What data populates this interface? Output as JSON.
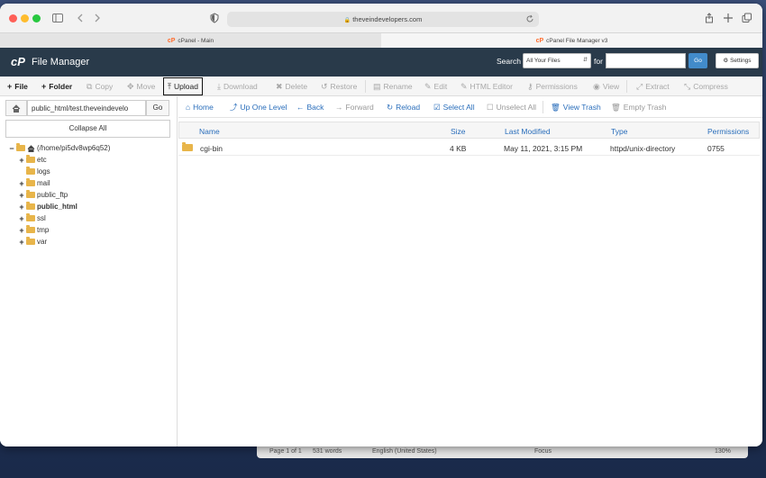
{
  "browser": {
    "url": "theveindevelopers.com",
    "tabs": [
      {
        "label": "cPanel - Main",
        "active": false
      },
      {
        "label": "cPanel File Manager v3",
        "active": true
      }
    ]
  },
  "header": {
    "logo": "cP",
    "title": "File Manager",
    "search_label": "Search",
    "search_scope": "All Your Files",
    "for_label": "for",
    "search_value": "",
    "go_label": "Go",
    "settings_label": "Settings"
  },
  "toolbar": {
    "file": "File",
    "folder": "Folder",
    "copy": "Copy",
    "move": "Move",
    "upload": "Upload",
    "download": "Download",
    "delete": "Delete",
    "restore": "Restore",
    "rename": "Rename",
    "edit": "Edit",
    "html_editor": "HTML Editor",
    "permissions": "Permissions",
    "view": "View",
    "extract": "Extract",
    "compress": "Compress"
  },
  "sidebar": {
    "path": "public_html/test.theveindevelo",
    "go_label": "Go",
    "collapse_label": "Collapse All",
    "root": "(/home/pi5dv8wp6q52)",
    "tree": [
      {
        "name": "etc",
        "expandable": true
      },
      {
        "name": "logs",
        "expandable": false
      },
      {
        "name": "mail",
        "expandable": true
      },
      {
        "name": "public_ftp",
        "expandable": true
      },
      {
        "name": "public_html",
        "expandable": true
      },
      {
        "name": "ssl",
        "expandable": true
      },
      {
        "name": "tmp",
        "expandable": true
      },
      {
        "name": "var",
        "expandable": true
      }
    ]
  },
  "nav": {
    "home": "Home",
    "up": "Up One Level",
    "back": "Back",
    "forward": "Forward",
    "reload": "Reload",
    "select_all": "Select All",
    "unselect_all": "Unselect All",
    "view_trash": "View Trash",
    "empty_trash": "Empty Trash"
  },
  "table": {
    "columns": [
      "Name",
      "Size",
      "Last Modified",
      "Type",
      "Permissions"
    ],
    "rows": [
      [
        "cgi-bin",
        "4 KB",
        "May 11, 2021, 3:15 PM",
        "httpd/unix-directory",
        "0755"
      ]
    ]
  },
  "background_status": {
    "page": "Page 1 of 1",
    "words": "531 words",
    "language": "English (United States)",
    "focus": "Focus",
    "zoom": "130%"
  },
  "colors": {
    "header_bg": "#293a4a",
    "link_blue": "#2a6ebb",
    "go_blue": "#428bca",
    "folder": "#e8b54a"
  }
}
